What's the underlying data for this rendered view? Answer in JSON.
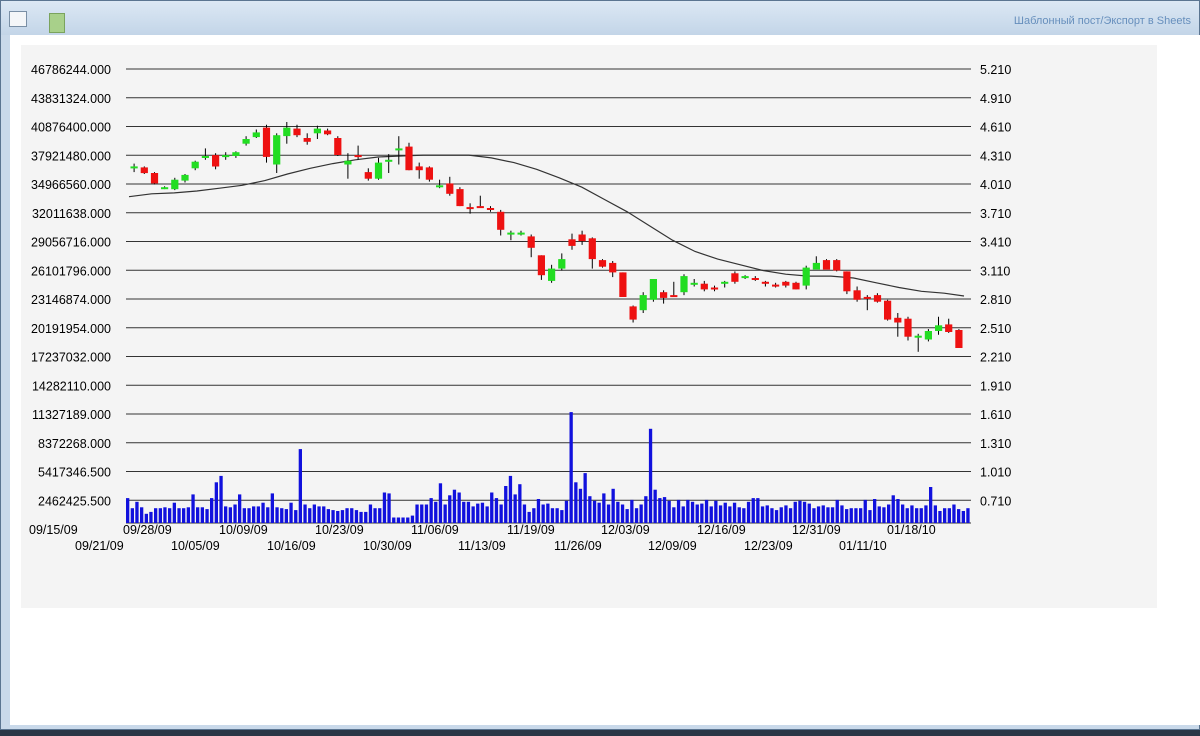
{
  "window": {
    "title": "Шаблонный пост/Экспорт в Sheets",
    "app_icon": "document-icon",
    "secondary_icon": "green-file-icon"
  },
  "colors": {
    "up": "#22dd22",
    "down": "#ee1111",
    "volume": "#1111dd",
    "ma": "#333333",
    "grid": "#333333",
    "panel_bg": "#f4f4f4"
  },
  "chart_data": {
    "type": "candlestick",
    "grid": true,
    "left_axis": {
      "ticks": [
        "46786244.000",
        "43831324.000",
        "40876400.000",
        "37921480.000",
        "34966560.000",
        "32011638.000",
        "29056716.000",
        "26101796.000",
        "23146874.000",
        "20191954.000",
        "17237032.000",
        "14282110.000",
        "11327189.000",
        "8372268.000",
        "5417346.500",
        "2462425.500"
      ],
      "ylim": [
        0,
        46786244
      ]
    },
    "right_axis": {
      "ticks": [
        "5.210",
        "4.910",
        "4.610",
        "4.310",
        "4.010",
        "3.710",
        "3.410",
        "3.110",
        "2.810",
        "2.510",
        "2.210",
        "1.910",
        "1.610",
        "1.310",
        "1.010",
        "0.710"
      ],
      "ylim": [
        0.41,
        5.21
      ]
    },
    "x_labels": {
      "row1": [
        "09/15/09",
        "09/28/09",
        "10/09/09",
        "10/23/09",
        "11/06/09",
        "11/19/09",
        "12/03/09",
        "12/16/09",
        "12/31/09",
        "01/18/10"
      ],
      "row2": [
        "09/21/09",
        "10/05/09",
        "10/16/09",
        "10/30/09",
        "11/13/09",
        "11/26/09",
        "12/09/09",
        "12/23/09",
        "01/11/10"
      ]
    },
    "candles": [
      [
        4.18,
        4.21,
        4.12,
        4.18
      ],
      [
        4.17,
        4.18,
        4.1,
        4.11
      ],
      [
        4.11,
        4.12,
        3.99,
        4.0
      ],
      [
        3.96,
        3.97,
        3.94,
        3.96
      ],
      [
        3.94,
        4.06,
        3.93,
        4.04
      ],
      [
        4.03,
        4.1,
        4.01,
        4.09
      ],
      [
        4.16,
        4.24,
        4.14,
        4.23
      ],
      [
        4.27,
        4.37,
        4.25,
        4.29
      ],
      [
        4.3,
        4.32,
        4.15,
        4.18
      ],
      [
        4.29,
        4.33,
        4.25,
        4.3
      ],
      [
        4.29,
        4.34,
        4.27,
        4.33
      ],
      [
        4.42,
        4.5,
        4.4,
        4.47
      ],
      [
        4.49,
        4.57,
        4.48,
        4.54
      ],
      [
        4.59,
        4.62,
        4.22,
        4.28
      ],
      [
        4.2,
        4.53,
        4.11,
        4.51
      ],
      [
        4.5,
        4.65,
        4.42,
        4.59
      ],
      [
        4.58,
        4.62,
        4.49,
        4.51
      ],
      [
        4.48,
        4.53,
        4.41,
        4.44
      ],
      [
        4.53,
        4.61,
        4.47,
        4.58
      ],
      [
        4.56,
        4.58,
        4.51,
        4.52
      ],
      [
        4.48,
        4.5,
        4.29,
        4.3
      ],
      [
        4.2,
        4.32,
        4.05,
        4.24
      ],
      [
        4.3,
        4.4,
        4.25,
        4.29
      ],
      [
        4.12,
        4.16,
        4.03,
        4.05
      ],
      [
        4.05,
        4.27,
        4.04,
        4.22
      ],
      [
        4.24,
        4.31,
        4.11,
        4.25
      ],
      [
        4.36,
        4.5,
        4.2,
        4.37
      ],
      [
        4.39,
        4.43,
        4.14,
        4.14
      ],
      [
        4.18,
        4.22,
        4.05,
        4.14
      ],
      [
        4.17,
        4.18,
        4.02,
        4.04
      ],
      [
        3.97,
        4.04,
        3.95,
        3.98
      ],
      [
        4.0,
        4.07,
        3.87,
        3.89
      ],
      [
        3.94,
        3.96,
        3.76,
        3.76
      ],
      [
        3.75,
        3.79,
        3.68,
        3.74
      ],
      [
        3.76,
        3.87,
        3.74,
        3.74
      ],
      [
        3.74,
        3.76,
        3.7,
        3.72
      ],
      [
        3.7,
        3.72,
        3.45,
        3.51
      ],
      [
        3.48,
        3.5,
        3.4,
        3.48
      ],
      [
        3.48,
        3.5,
        3.45,
        3.48
      ],
      [
        3.44,
        3.46,
        3.22,
        3.32
      ],
      [
        3.24,
        3.24,
        2.98,
        3.03
      ],
      [
        2.97,
        3.14,
        2.95,
        3.1
      ],
      [
        3.1,
        3.26,
        3.08,
        3.2
      ],
      [
        3.41,
        3.47,
        3.3,
        3.34
      ],
      [
        3.46,
        3.5,
        3.35,
        3.39
      ],
      [
        3.42,
        3.43,
        3.1,
        3.2
      ],
      [
        3.19,
        3.2,
        3.11,
        3.12
      ],
      [
        3.16,
        3.18,
        3.01,
        3.06
      ],
      [
        3.06,
        3.06,
        2.8,
        2.8
      ],
      [
        2.7,
        2.71,
        2.53,
        2.56
      ],
      [
        2.66,
        2.85,
        2.63,
        2.82
      ],
      [
        2.77,
        2.99,
        2.75,
        2.99
      ],
      [
        2.85,
        2.87,
        2.73,
        2.79
      ],
      [
        2.82,
        2.96,
        2.81,
        2.81
      ],
      [
        2.85,
        3.04,
        2.82,
        3.02
      ],
      [
        2.95,
        2.99,
        2.91,
        2.95
      ],
      [
        2.94,
        2.97,
        2.86,
        2.88
      ],
      [
        2.9,
        2.92,
        2.86,
        2.89
      ],
      [
        2.95,
        2.97,
        2.9,
        2.96
      ],
      [
        3.05,
        3.07,
        2.94,
        2.96
      ],
      [
        3.02,
        3.03,
        2.99,
        3.02
      ],
      [
        3.0,
        3.02,
        2.97,
        2.98
      ],
      [
        2.96,
        2.97,
        2.91,
        2.94
      ],
      [
        2.93,
        2.95,
        2.9,
        2.92
      ],
      [
        2.96,
        2.97,
        2.9,
        2.92
      ],
      [
        2.95,
        2.96,
        2.88,
        2.88
      ],
      [
        2.92,
        3.13,
        2.88,
        3.11
      ],
      [
        3.09,
        3.23,
        3.09,
        3.16
      ],
      [
        3.19,
        3.2,
        3.09,
        3.09
      ],
      [
        3.19,
        3.2,
        3.07,
        3.08
      ],
      [
        3.07,
        3.07,
        2.83,
        2.86
      ],
      [
        2.87,
        2.91,
        2.75,
        2.77
      ],
      [
        2.8,
        2.82,
        2.66,
        2.79
      ],
      [
        2.82,
        2.84,
        2.74,
        2.75
      ],
      [
        2.76,
        2.77,
        2.55,
        2.56
      ],
      [
        2.58,
        2.63,
        2.38,
        2.53
      ],
      [
        2.57,
        2.59,
        2.34,
        2.38
      ],
      [
        2.39,
        2.41,
        2.22,
        2.39
      ],
      [
        2.35,
        2.46,
        2.33,
        2.44
      ],
      [
        2.44,
        2.59,
        2.4,
        2.5
      ],
      [
        2.51,
        2.57,
        2.42,
        2.43
      ],
      [
        2.45,
        2.46,
        2.26,
        2.26
      ]
    ],
    "volume_million": [
      2.7,
      1.6,
      2.3,
      1.7,
      1.0,
      1.2,
      1.6,
      1.6,
      1.7,
      1.6,
      2.2,
      1.6,
      1.6,
      1.7,
      3.1,
      1.7,
      1.7,
      1.5,
      2.7,
      4.4,
      5.1,
      1.8,
      1.7,
      2.0,
      3.1,
      1.6,
      1.6,
      1.8,
      1.8,
      2.2,
      1.7,
      3.2,
      1.7,
      1.6,
      1.5,
      2.2,
      1.4,
      8.0,
      2.0,
      1.6,
      2.0,
      1.8,
      1.8,
      1.5,
      1.4,
      1.3,
      1.4,
      1.6,
      1.6,
      1.4,
      1.2,
      1.2,
      2.0,
      1.6,
      1.6,
      3.3,
      3.2,
      0.6,
      0.6,
      0.6,
      0.6,
      0.8,
      2.0,
      2.0,
      2.0,
      2.7,
      2.3,
      4.3,
      2.0,
      3.0,
      3.6,
      3.3,
      2.3,
      2.3,
      1.8,
      2.1,
      2.2,
      1.8,
      3.3,
      2.7,
      2.0,
      4.0,
      5.1,
      3.1,
      4.2,
      2.0,
      1.2,
      1.6,
      2.6,
      2.0,
      2.1,
      1.6,
      1.6,
      1.4,
      2.4,
      12.0,
      4.4,
      3.7,
      5.4,
      2.9,
      2.4,
      2.2,
      3.2,
      2.0,
      3.7,
      2.3,
      2.0,
      1.5,
      2.5,
      1.6,
      2.0,
      2.9,
      10.2,
      3.6,
      2.7,
      2.8,
      2.4,
      1.7,
      2.5,
      1.8,
      2.5,
      2.3,
      2.0,
      2.1,
      2.5,
      1.8,
      2.4,
      1.9,
      2.2,
      1.8,
      2.2,
      1.7,
      1.6,
      2.3,
      2.7,
      2.7,
      1.8,
      1.9,
      1.6,
      1.4,
      1.7,
      1.9,
      1.6,
      2.3,
      2.4,
      2.3,
      2.1,
      1.6,
      1.8,
      1.9,
      1.7,
      1.7,
      2.5,
      1.9,
      1.5,
      1.6,
      1.6,
      1.6,
      2.5,
      1.4,
      2.6,
      1.8,
      1.7,
      2.0,
      3.0,
      2.6,
      2.0,
      1.6,
      1.9,
      1.6,
      1.6,
      1.9,
      3.9,
      1.9,
      1.3,
      1.6,
      1.6,
      2.0,
      1.5,
      1.3,
      1.6
    ],
    "moving_average": [
      [
        0,
        3.86
      ],
      [
        8,
        3.89
      ],
      [
        16,
        3.9
      ],
      [
        24,
        3.92
      ],
      [
        32,
        3.95
      ],
      [
        40,
        3.98
      ],
      [
        48,
        4.03
      ],
      [
        56,
        4.1
      ],
      [
        64,
        4.16
      ],
      [
        72,
        4.21
      ],
      [
        80,
        4.25
      ],
      [
        88,
        4.28
      ],
      [
        96,
        4.29
      ],
      [
        104,
        4.3
      ],
      [
        112,
        4.3
      ],
      [
        120,
        4.3
      ],
      [
        128,
        4.27
      ],
      [
        136,
        4.22
      ],
      [
        144,
        4.15
      ],
      [
        152,
        4.06
      ],
      [
        160,
        3.96
      ],
      [
        168,
        3.83
      ],
      [
        176,
        3.7
      ],
      [
        184,
        3.55
      ],
      [
        192,
        3.4
      ],
      [
        200,
        3.28
      ],
      [
        208,
        3.2
      ],
      [
        216,
        3.14
      ],
      [
        224,
        3.08
      ],
      [
        232,
        3.04
      ],
      [
        240,
        3.02
      ],
      [
        248,
        3.02
      ],
      [
        256,
        3.0
      ],
      [
        264,
        2.95
      ],
      [
        272,
        2.9
      ],
      [
        280,
        2.86
      ],
      [
        288,
        2.84
      ],
      [
        295,
        2.81
      ]
    ]
  }
}
